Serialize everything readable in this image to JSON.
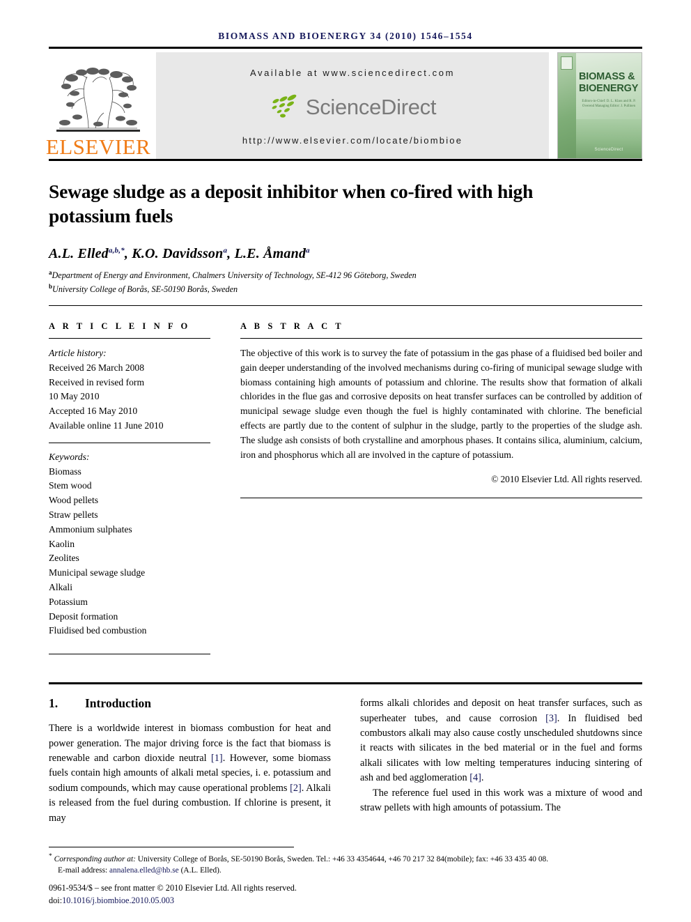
{
  "running_head": "BIOMASS AND BIOENERGY 34 (2010) 1546–1554",
  "masthead": {
    "publisher_name": "ELSEVIER",
    "available_at": "Available at www.sciencedirect.com",
    "logo_word": "ScienceDirect",
    "journal_url": "http://www.elsevier.com/locate/biombioe",
    "cover": {
      "title_line1": "BIOMASS &",
      "title_line2": "BIOENERGY",
      "editors": "Editors-in-Chief: D. L. Klass and R. P. Overend\nManaging Editor: J. Pullinen",
      "logo": "ScienceDirect"
    }
  },
  "article": {
    "title": "Sewage sludge as a deposit inhibitor when co-fired with high potassium fuels",
    "authors": [
      {
        "name": "A.L. Elled",
        "sup": "a,b,*"
      },
      {
        "name": "K.O. Davidsson",
        "sup": "a"
      },
      {
        "name": "L.E. Åmand",
        "sup": "a"
      }
    ],
    "affiliations": [
      {
        "marker": "a",
        "text": "Department of Energy and Environment, Chalmers University of Technology, SE-412 96 Göteborg, Sweden"
      },
      {
        "marker": "b",
        "text": "University College of Borås, SE-50190 Borås, Sweden"
      }
    ]
  },
  "info": {
    "heading": "A R T I C L E   I N F O",
    "history_label": "Article history:",
    "history": [
      "Received 26 March 2008",
      "Received in revised form",
      "10 May 2010",
      "Accepted 16 May 2010",
      "Available online 11 June 2010"
    ],
    "keywords_label": "Keywords:",
    "keywords": [
      "Biomass",
      "Stem wood",
      "Wood pellets",
      "Straw pellets",
      "Ammonium sulphates",
      "Kaolin",
      "Zeolites",
      "Municipal sewage sludge",
      "Alkali",
      "Potassium",
      "Deposit formation",
      "Fluidised bed combustion"
    ]
  },
  "abstract": {
    "heading": "A B S T R A C T",
    "text": "The objective of this work is to survey the fate of potassium in the gas phase of a fluidised bed boiler and gain deeper understanding of the involved mechanisms during co-firing of municipal sewage sludge with biomass containing high amounts of potassium and chlorine. The results show that formation of alkali chlorides in the flue gas and corrosive deposits on heat transfer surfaces can be controlled by addition of municipal sewage sludge even though the fuel is highly contaminated with chlorine. The beneficial effects are partly due to the content of sulphur in the sludge, partly to the properties of the sludge ash. The sludge ash consists of both crystalline and amorphous phases. It contains silica, aluminium, calcium, iron and phosphorus which all are involved in the capture of potassium.",
    "copyright": "© 2010 Elsevier Ltd. All rights reserved."
  },
  "section": {
    "number": "1.",
    "heading": "Introduction",
    "left_paragraph_1_a": "There is a worldwide interest in biomass combustion for heat and power generation. The major driving force is the fact that biomass is renewable and carbon dioxide neutral ",
    "ref1": "[1]",
    "left_paragraph_1_b": ". However, some biomass fuels contain high amounts of alkali metal species, i. e. potassium and sodium compounds, which may cause operational problems ",
    "ref2": "[2]",
    "left_paragraph_1_c": ". Alkali is released from the fuel during combustion. If chlorine is present, it may",
    "right_paragraph_1_a": "forms alkali chlorides and deposit on heat transfer surfaces, such as superheater tubes, and cause corrosion ",
    "ref3": "[3]",
    "right_paragraph_1_b": ". In fluidised bed combustors alkali may also cause costly unscheduled shutdowns since it reacts with silicates in the bed material or in the fuel and forms alkali silicates with low melting temperatures inducing sintering of ash and bed agglomeration ",
    "ref4": "[4]",
    "right_paragraph_1_c": ".",
    "right_paragraph_2": "The reference fuel used in this work was a mixture of wood and straw pellets with high amounts of potassium. The"
  },
  "footnotes": {
    "corresponding_marker": "*",
    "corresponding_label": "Corresponding author at:",
    "corresponding_text": " University College of Borås, SE-50190 Borås, Sweden. Tel.: +46 33 4354644, +46 70 217 32 84(mobile); fax: +46 33 435 40 08.",
    "email_label": "E-mail address:",
    "email": "annalena.elled@hb.se",
    "email_owner": "(A.L. Elled).",
    "issn_line": "0961-9534/$ – see front matter © 2010 Elsevier Ltd. All rights reserved.",
    "doi_label": "doi:",
    "doi": "10.1016/j.biombioe.2010.05.003"
  }
}
